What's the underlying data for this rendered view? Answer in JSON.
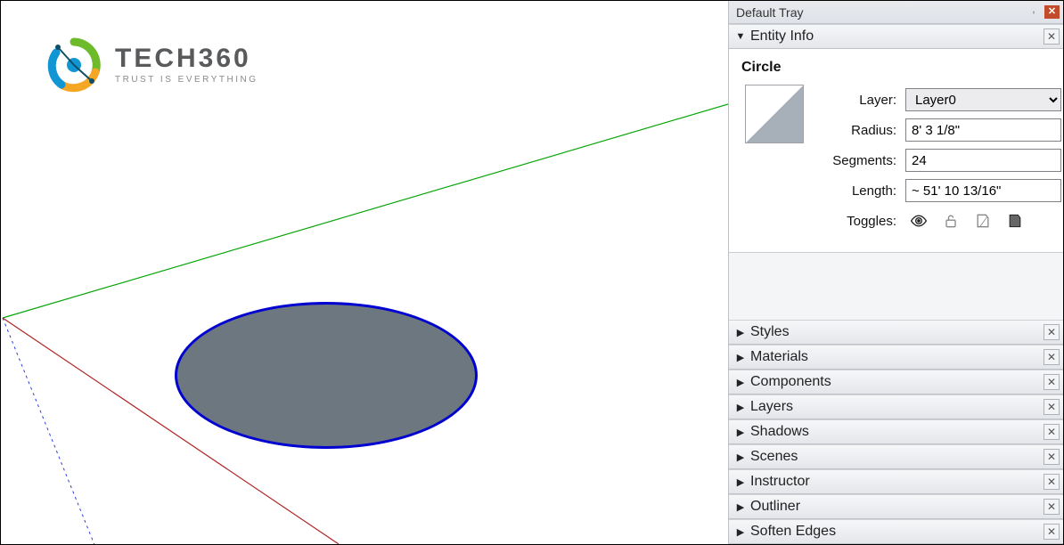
{
  "logo": {
    "brand": "TECH360",
    "tagline": "TRUST IS EVERYTHING"
  },
  "tray": {
    "title": "Default Tray"
  },
  "entity_info": {
    "header": "Entity Info",
    "type": "Circle",
    "layer_label": "Layer:",
    "layer_value": "Layer0",
    "radius_label": "Radius:",
    "radius_value": "8' 3 1/8\"",
    "segments_label": "Segments:",
    "segments_value": "24",
    "length_label": "Length:",
    "length_value": "~ 51' 10 13/16\"",
    "toggles_label": "Toggles:"
  },
  "sections": [
    "Styles",
    "Materials",
    "Components",
    "Layers",
    "Shadows",
    "Scenes",
    "Instructor",
    "Outliner",
    "Soften Edges"
  ]
}
